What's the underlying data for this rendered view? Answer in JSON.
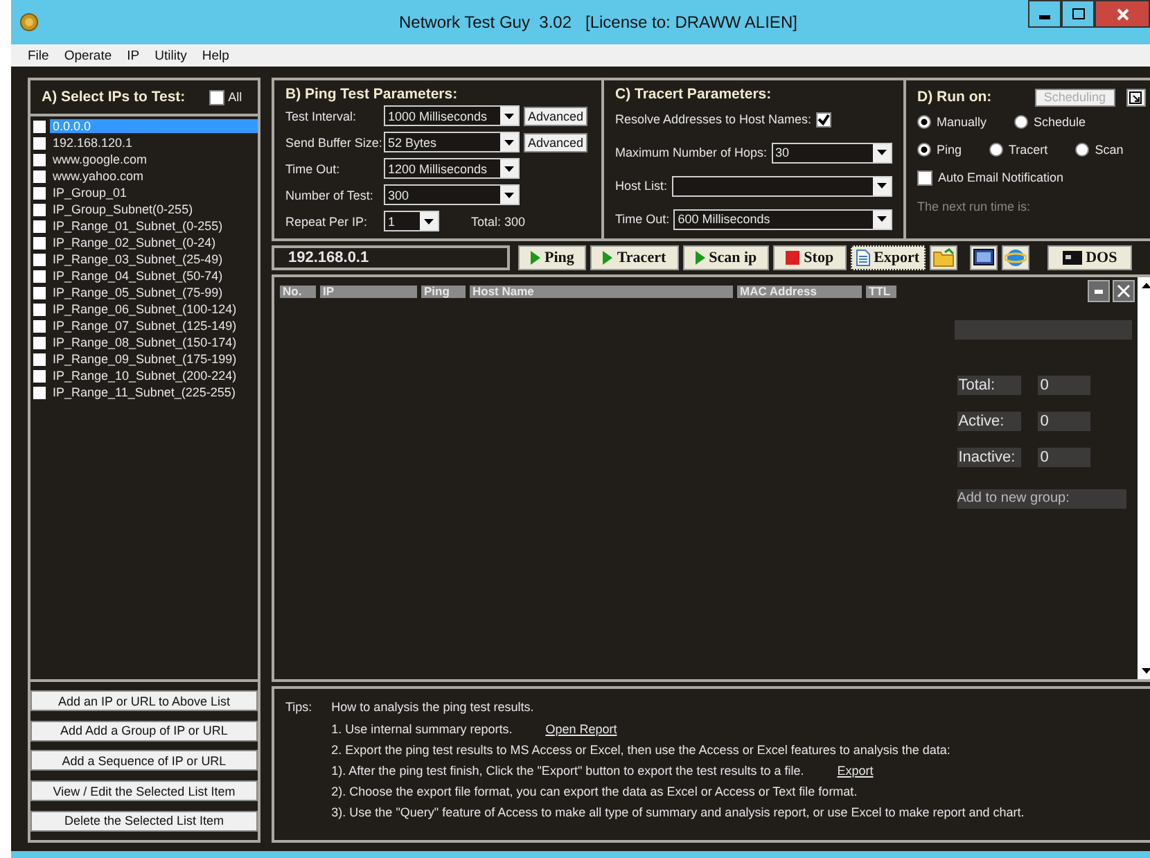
{
  "window": {
    "title": "Network Test Guy  3.02   [License to: DRAWW ALIEN]"
  },
  "menu": [
    "File",
    "Operate",
    "IP",
    "Utility",
    "Help"
  ],
  "select_panel": {
    "title": "A) Select IPs to Test:",
    "all_label": "All",
    "all_checked": false,
    "items": [
      {
        "label": "0.0.0.0",
        "checked": false,
        "selected": true
      },
      {
        "label": "192.168.120.1",
        "checked": false,
        "selected": false
      },
      {
        "label": "www.google.com",
        "checked": false,
        "selected": false
      },
      {
        "label": "www.yahoo.com",
        "checked": false,
        "selected": false
      },
      {
        "label": "IP_Group_01",
        "checked": false,
        "selected": false
      },
      {
        "label": "IP_Group_Subnet(0-255)",
        "checked": false,
        "selected": false
      },
      {
        "label": "IP_Range_01_Subnet_(0-255)",
        "checked": false,
        "selected": false
      },
      {
        "label": "IP_Range_02_Subnet_(0-24)",
        "checked": false,
        "selected": false
      },
      {
        "label": "IP_Range_03_Subnet_(25-49)",
        "checked": false,
        "selected": false
      },
      {
        "label": "IP_Range_04_Subnet_(50-74)",
        "checked": false,
        "selected": false
      },
      {
        "label": "IP_Range_05_Subnet_(75-99)",
        "checked": false,
        "selected": false
      },
      {
        "label": "IP_Range_06_Subnet_(100-124)",
        "checked": false,
        "selected": false
      },
      {
        "label": "IP_Range_07_Subnet_(125-149)",
        "checked": false,
        "selected": false
      },
      {
        "label": "IP_Range_08_Subnet_(150-174)",
        "checked": false,
        "selected": false
      },
      {
        "label": "IP_Range_09_Subnet_(175-199)",
        "checked": false,
        "selected": false
      },
      {
        "label": "IP_Range_10_Subnet_(200-224)",
        "checked": false,
        "selected": false
      },
      {
        "label": "IP_Range_11_Subnet_(225-255)",
        "checked": false,
        "selected": false
      }
    ],
    "buttons": [
      "Add an IP or URL to Above List",
      "Add Add a Group of IP or URL",
      "Add a Sequence of IP or URL",
      "View / Edit the Selected List Item",
      "Delete the Selected List Item"
    ]
  },
  "ping_params": {
    "title": "B) Ping Test Parameters:",
    "fields": [
      {
        "label": "Test Interval:",
        "value": "1000  Milliseconds",
        "button": "Advanced"
      },
      {
        "label": "Send Buffer Size:",
        "value": "52  Bytes",
        "button": "Advanced"
      },
      {
        "label": "Time Out:",
        "value": "1200  Milliseconds"
      },
      {
        "label": "Number of Test:",
        "value": "300"
      }
    ],
    "repeat": {
      "label": "Repeat Per IP:",
      "value": "1",
      "total": "Total: 300"
    }
  },
  "tracert_params": {
    "title": "C) Tracert Parameters:",
    "resolve": {
      "label": "Resolve Addresses to Host Names:",
      "checked": true
    },
    "fields": [
      {
        "label": "Maximum Number of Hops:",
        "value": "30"
      },
      {
        "label": "Host List:"
      },
      {
        "label": "Time Out:",
        "value": "600  Milliseconds"
      }
    ]
  },
  "run_on": {
    "title": "D) Run on:",
    "scheduling_button": "Scheduling",
    "modes": [
      {
        "label": "Manually",
        "selected": true
      },
      {
        "label": "Schedule",
        "selected": false
      }
    ],
    "tasks": [
      {
        "label": "Ping",
        "selected": true
      },
      {
        "label": "Tracert",
        "selected": false
      },
      {
        "label": "Scan",
        "selected": false
      }
    ],
    "auto_email": {
      "label": "Auto Email Notification",
      "checked": false
    },
    "next_run_label": "The next run time is:"
  },
  "toolbar": {
    "address": "192.168.0.1",
    "buttons": [
      {
        "kind": "play",
        "label": "Ping"
      },
      {
        "kind": "play",
        "label": "Tracert"
      },
      {
        "kind": "play",
        "label": "Scan ip"
      },
      {
        "kind": "stop",
        "label": "Stop"
      },
      {
        "kind": "export",
        "label": "Export"
      },
      {
        "kind": "folder"
      },
      {
        "kind": "screen"
      },
      {
        "kind": "globe"
      },
      {
        "kind": "dos",
        "label": "DOS"
      }
    ]
  },
  "results": {
    "columns": [
      "No.",
      "IP",
      "Ping",
      "Host Name",
      "MAC Address",
      "TTL"
    ],
    "summary": [
      {
        "label": "Total:",
        "value": "0"
      },
      {
        "label": "Active:",
        "value": "0"
      },
      {
        "label": "Inactive:",
        "value": "0"
      }
    ],
    "add_group_label": "Add to new group:"
  },
  "tips": {
    "label": "Tips:",
    "heading": "How to analysis the ping test results.",
    "lines": [
      {
        "text": "1.  Use internal summary reports.",
        "link": "Open Report"
      },
      {
        "text": "2.  Export the ping test results to MS Access or Excel, then use the Access or Excel features to analysis the data:"
      },
      {
        "text": "1).  After the ping test finish, Click the \"Export\" button to export the test results to a file.",
        "link": "Export"
      },
      {
        "text": "2).  Choose the export file format, you can export the data as Excel or Access or Text file format."
      },
      {
        "text": "3).  Use the \"Query\" feature of Access to make all type of summary and analysis report, or use Excel to make report and chart."
      }
    ]
  }
}
